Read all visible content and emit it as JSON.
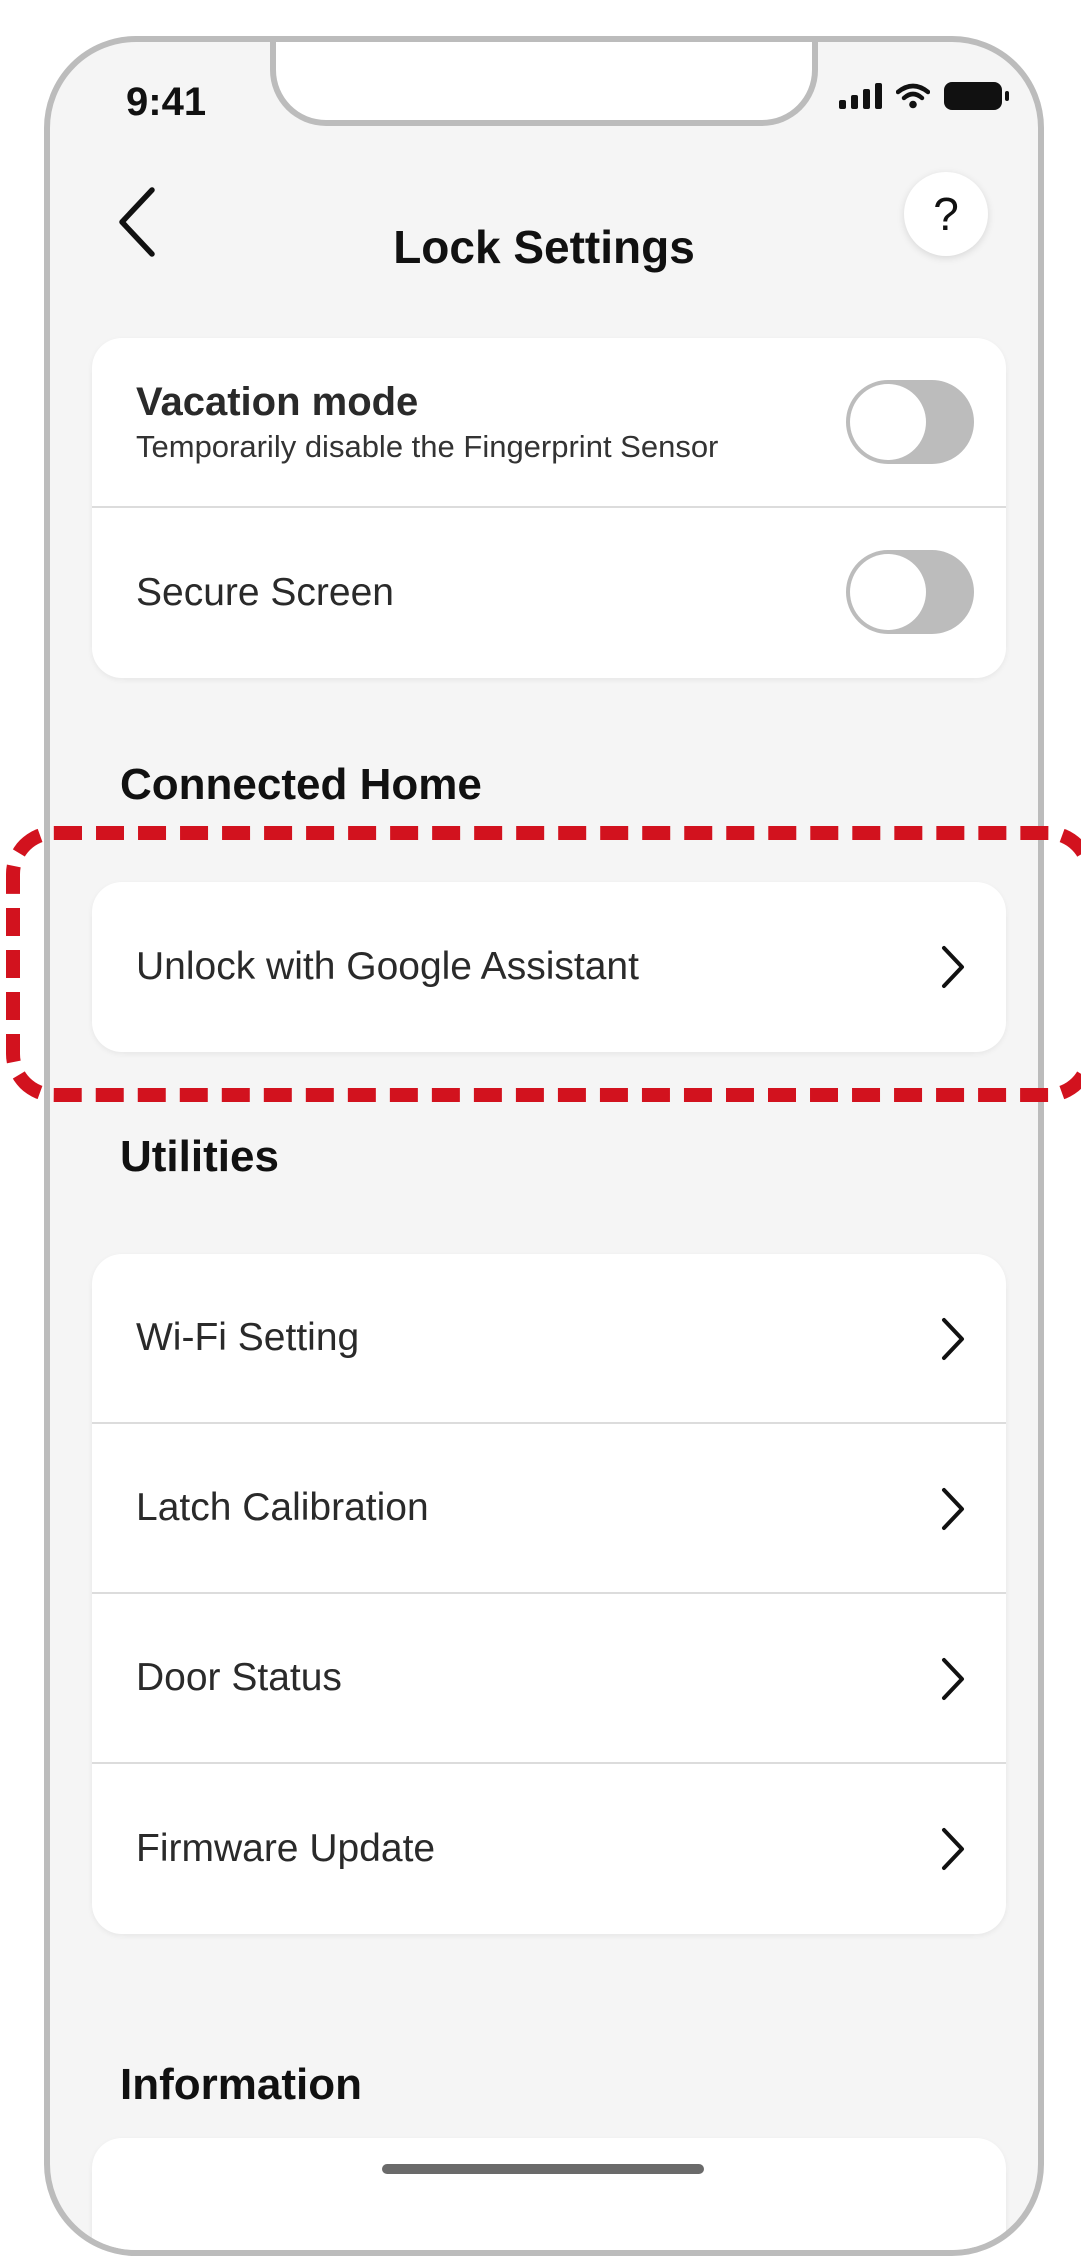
{
  "status_bar": {
    "time": "9:41",
    "icons": [
      "cellular-signal-icon",
      "wifi-icon",
      "battery-icon"
    ]
  },
  "header": {
    "title": "Lock Settings",
    "back_icon": "chevron-left-icon",
    "help_label": "?"
  },
  "settings_card": {
    "vacation": {
      "title": "Vacation mode",
      "subtitle": "Temporarily disable the Fingerprint Sensor",
      "enabled": false
    },
    "secure_screen": {
      "label": "Secure Screen",
      "enabled": false
    }
  },
  "connected_home": {
    "title": "Connected Home",
    "items": [
      {
        "label": "Unlock with Google Assistant"
      }
    ]
  },
  "utilities": {
    "title": "Utilities",
    "items": [
      {
        "label": "Wi-Fi Setting"
      },
      {
        "label": "Latch Calibration"
      },
      {
        "label": "Door Status"
      },
      {
        "label": "Firmware Update"
      }
    ]
  },
  "information": {
    "title": "Information"
  },
  "colors": {
    "highlight": "#d2121e",
    "toggle_off": "#bcbcbc",
    "background": "#f5f5f5"
  }
}
